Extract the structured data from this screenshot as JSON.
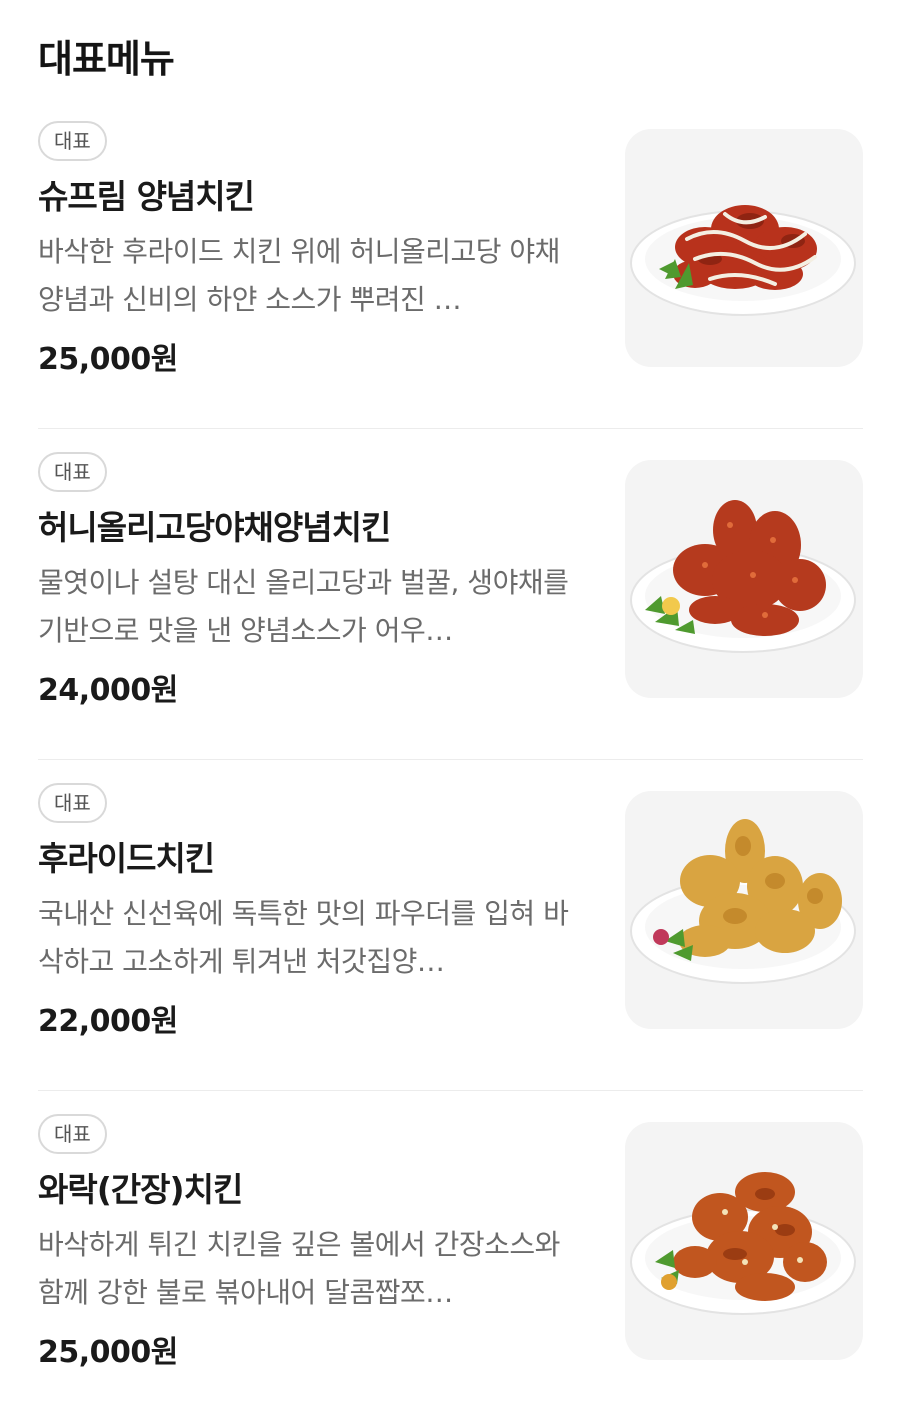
{
  "section": {
    "title": "대표메뉴"
  },
  "menu": [
    {
      "badge": "대표",
      "name": "슈프림 양념치킨",
      "description": "바삭한 후라이드 치킨 위에 허니올리고당 야채양념과 신비의 하얀 소스가 뿌려진 …",
      "price": "25,000원",
      "image_icon": "supreme-seasoned-chicken-image"
    },
    {
      "badge": "대표",
      "name": "허니올리고당야채양념치킨",
      "description": "물엿이나 설탕 대신 올리고당과 벌꿀, 생야채를 기반으로 맛을 낸 양념소스가 어우…",
      "price": "24,000원",
      "image_icon": "seasoned-chicken-image"
    },
    {
      "badge": "대표",
      "name": "후라이드치킨",
      "description": "국내산 신선육에 독특한 맛의 파우더를 입혀 바삭하고 고소하게 튀겨낸 처갓집양…",
      "price": "22,000원",
      "image_icon": "fried-chicken-image"
    },
    {
      "badge": "대표",
      "name": "와락(간장)치킨",
      "description": "바삭하게 튀긴 치킨을 깊은 볼에서 간장소스와 함께 강한 불로 볶아내어 달콤짭쪼…",
      "price": "25,000원",
      "image_icon": "soy-sauce-chicken-image"
    }
  ],
  "colors": {
    "seasoned": "#b8321c",
    "fried": "#d9a441",
    "soy": "#c1561f",
    "garnish": "#4f9a2f"
  }
}
